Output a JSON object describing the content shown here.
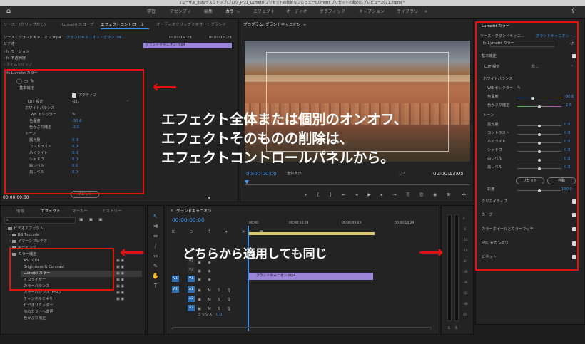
{
  "window": {
    "title": "/ユーザ/k_itoh/デスクトップ/ブログ_Pr21_Lumetri プリセットの動的なプレビュー/Lumetri プリセットの動的なプレビュー2021.prproj *"
  },
  "workspaces": [
    "学習",
    "アセンブリ",
    "編集",
    "カラー",
    "エフェクト",
    "オーディオ",
    "グラフィック",
    "キャプション",
    "ライブラリ"
  ],
  "left_panel": {
    "tabs": [
      "ソース：(クリップなし)",
      "Lumetri スコープ",
      "エフェクトコントロール",
      "オーディオクリップミキサー：グランド"
    ],
    "source_tab": "ソース・グランドキャニオン.mp4",
    "sequence_tab": "グランドキャニオン・グランドキ...",
    "video_label": "ビデオ",
    "timecodes": {
      "t1": "00:00:04:29",
      "t2": "00:00:09:29"
    },
    "clip_label": "グランドキャニオン.mp4",
    "effects": [
      "モーション",
      "不透明度",
      "タイムリマップ",
      "Lumetri カラー"
    ],
    "section_basic": "基本補正",
    "active_label": "アクティブ",
    "lut_label": "LUT 設定",
    "lut_value": "なし",
    "wb_label": "ホワイトバランス",
    "wb_selector": "WB セレクター",
    "temp_label": "色温度",
    "temp_value": "-30.6",
    "tint_label": "色かぶり補正",
    "tint_value": "-2.6",
    "tone_label": "トーン",
    "tone_items": [
      "露光量",
      "コントラスト",
      "ハイライト",
      "シャドウ",
      "白レベル",
      "黒レベル"
    ],
    "tone_values": [
      "0.0",
      "0.0",
      "0.0",
      "0.0",
      "0.0",
      "0.0"
    ],
    "reset_label": "リセット",
    "timecode": "00:00:00:00"
  },
  "program": {
    "title": "プログラム: グランドキャニオン",
    "timecode_left": "00:00:00:00",
    "fit_label": "全体表示",
    "quality": "1/2",
    "timecode_right": "00:00:13:05"
  },
  "lumetri": {
    "title": "Lumetri カラー",
    "source_label": "ソース・グランドキャニ...",
    "seq_label": "グランドキャニオン・...",
    "fx_name": "Lumetri カラー",
    "sections": [
      "基本補正",
      "クリエイティブ",
      "カーブ",
      "カラーホイールとカラーマッチ",
      "HSL セカンダリ",
      "ビネット"
    ],
    "lut_label": "LUT 設定",
    "lut_value": "なし",
    "wb_label": "ホワイトバランス",
    "wb_selector": "WB セレクター",
    "temp_label": "色温度",
    "temp_value": "-30.6",
    "tint_label": "色かぶり補正",
    "tint_value": "-2.6",
    "tone_label": "トーン",
    "tone_items": [
      "露光量",
      "コントラスト",
      "ハイライト",
      "シャドウ",
      "白レベル",
      "黒レベル"
    ],
    "tone_values": [
      "0.0",
      "0.0",
      "0.0",
      "0.0",
      "0.0",
      "0.0"
    ],
    "reset_label": "リセット",
    "auto_label": "自動",
    "saturation_label": "彩度",
    "saturation_value": "100.0"
  },
  "effects_panel": {
    "tabs": [
      "情報",
      "エフェクト",
      "マーカー",
      "ヒストリー"
    ],
    "items": [
      "ビデオエフェクト",
      "BG Topcode",
      "イマーシブビデオ",
      "キーイング",
      "カラー補正",
      "ASC CDL",
      "Brightness & Contrast",
      "Lumetri カラー",
      "イコライザー",
      "カラーバランス",
      "カラーバランス (HSL)",
      "チャンネルミキサー",
      "ビデオリミッター",
      "他のカラーへ変更",
      "色かぶり補正"
    ]
  },
  "timeline": {
    "title": "グランドキャニオン",
    "timecode": "00:00:00:00",
    "ruler": [
      "00:00",
      "00:00:04:29",
      "00:00:09:29",
      "00:00:14:29"
    ],
    "tracks_v": [
      "V3",
      "V2",
      "V1"
    ],
    "tracks_a": [
      "A1",
      "A2",
      "A3"
    ],
    "clip_label": "グランドキャニオン.mp4",
    "mix_label": "ミックス",
    "mix_value": "0.0"
  },
  "meter": {
    "labels": [
      "0",
      "-6",
      "-12",
      "-18",
      "-24",
      "-30",
      "-36",
      "-42",
      "-48",
      "-54"
    ],
    "bottom": [
      "S",
      "S"
    ]
  },
  "annotations": {
    "line1": "エフェクト全体または個別のオンオフ、",
    "line2": "エフェクトそのものの削除は、",
    "line3": "エフェクトコントロールパネルから。",
    "line4": "どちらから適用しても同じ"
  },
  "colors": {
    "accent": "#3d8fe8",
    "annotation": "#e0130d",
    "clip": "#9c85d8"
  }
}
